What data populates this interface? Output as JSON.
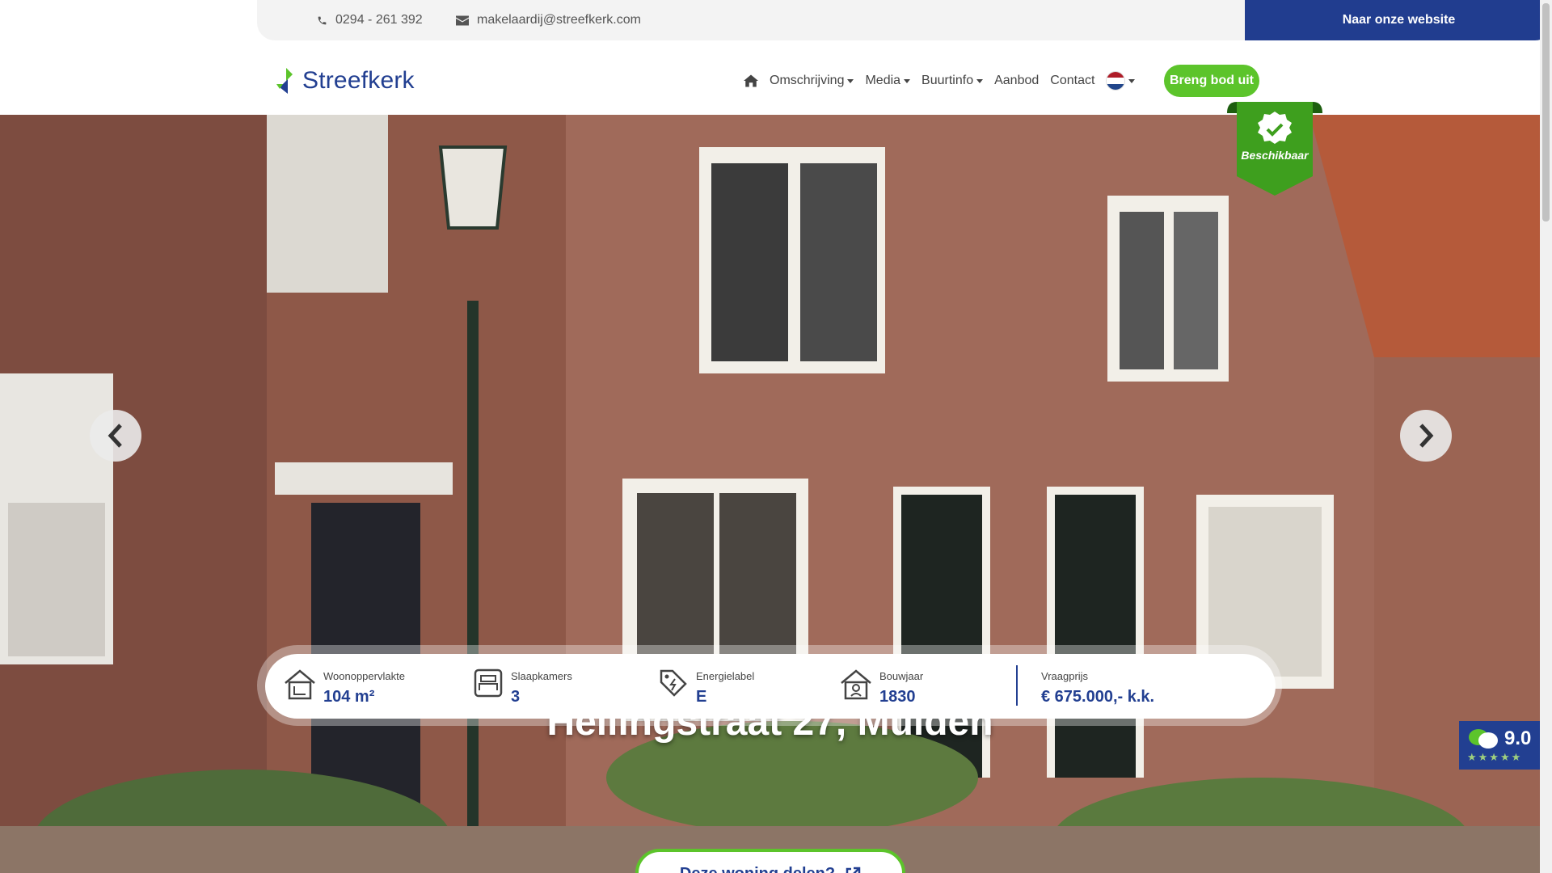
{
  "topbar": {
    "phone": "0294 - 261 392",
    "email": "makelaardij@streefkerk.com",
    "website_button": "Naar onze website"
  },
  "header": {
    "logo_text": "Streefkerk",
    "nav": [
      {
        "label": "Omschrijving"
      },
      {
        "label": "Media"
      },
      {
        "label": "Buurtinfo"
      },
      {
        "label": "Aanbod"
      },
      {
        "label": "Contact"
      }
    ],
    "bid_button": "Breng bod uit"
  },
  "hero": {
    "status": "Beschikbaar",
    "address": "Hellingstraat 27, Muiden",
    "rating": "9.0"
  },
  "specs": [
    {
      "label": "Woonoppervlakte",
      "value": "104 m²"
    },
    {
      "label": "Slaapkamers",
      "value": "3"
    },
    {
      "label": "Energielabel",
      "value": "E"
    },
    {
      "label": "Bouwjaar",
      "value": "1830"
    },
    {
      "label": "Vraagprijs",
      "value": "€ 675.000,- k.k."
    }
  ],
  "share_button": "Deze woning delen?",
  "colors": {
    "brand_blue": "#223f91",
    "brand_green": "#5cc42b"
  }
}
